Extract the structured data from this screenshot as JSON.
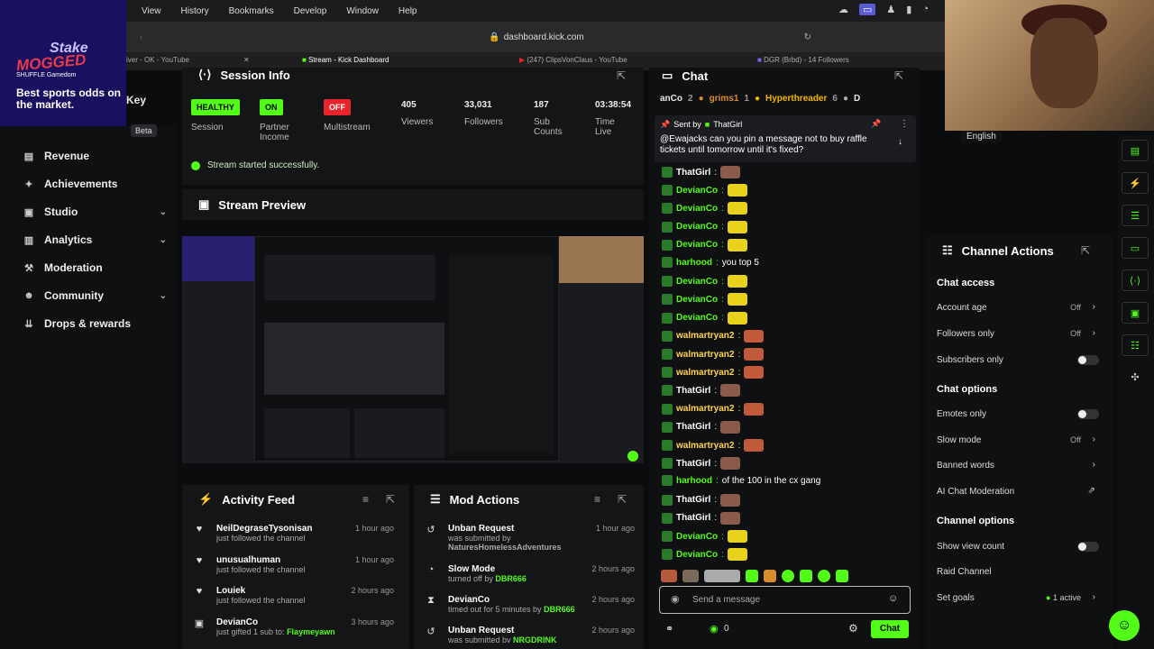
{
  "menubar": {
    "items": [
      "View",
      "History",
      "Bookmarks",
      "Develop",
      "Window",
      "Help"
    ]
  },
  "browser": {
    "url": "dashboard.kick.com",
    "tabs": [
      "iver - OK - YouTube",
      "Stream - Kick Dashboard",
      "(247) ClipsVonClaus - YouTube",
      "DGR (Brbd) - 14 Followers"
    ]
  },
  "promo": {
    "stake": "Stake",
    "mogged": "MOGGED",
    "brands": "SHUFFLE  Gamedom",
    "tagline": "Best sports odds on the market."
  },
  "webcam": {
    "language": "English"
  },
  "sidebar": {
    "partial_key": "Key",
    "beta": "Beta",
    "items": [
      {
        "label": "Revenue",
        "icon": "revenue-icon"
      },
      {
        "label": "Achievements",
        "icon": "achievements-icon"
      },
      {
        "label": "Studio",
        "icon": "studio-icon"
      },
      {
        "label": "Analytics",
        "icon": "analytics-icon"
      },
      {
        "label": "Moderation",
        "icon": "moderation-icon"
      },
      {
        "label": "Community",
        "icon": "community-icon"
      },
      {
        "label": "Drops & rewards",
        "icon": "drops-icon"
      }
    ]
  },
  "session": {
    "title": "Session Info",
    "metrics": [
      {
        "badge": "HEALTHY",
        "label": "Session",
        "color": "#53fc18"
      },
      {
        "badge": "ON",
        "label": "Partner Income",
        "color": "#53fc18"
      },
      {
        "badge": "OFF",
        "label": "Multistream",
        "color": "#e8232c"
      },
      {
        "value": "405",
        "label": "Viewers"
      },
      {
        "value": "33,031",
        "label": "Followers"
      },
      {
        "value": "187",
        "label": "Sub Counts"
      },
      {
        "value": "03:38:54",
        "label": "Time Live"
      }
    ],
    "success": "Stream started successfully."
  },
  "preview": {
    "title": "Stream Preview"
  },
  "activity": {
    "title": "Activity Feed",
    "items": [
      {
        "name": "NeilDegraseTysonisan",
        "sub": "just followed the channel",
        "time": "1 hour ago"
      },
      {
        "name": "unusualhuman",
        "sub": "just followed the channel",
        "time": "1 hour ago"
      },
      {
        "name": "Louiek",
        "sub": "just followed the channel",
        "time": "2 hours ago"
      },
      {
        "name": "DevianCo",
        "sub": "just gifted 1 sub to:",
        "target": "Flaymeyawn",
        "time": "3 hours ago"
      }
    ]
  },
  "mod": {
    "title": "Mod Actions",
    "items": [
      {
        "name": "Unban Request",
        "sub": "was submitted by",
        "target": "NaturesHomelessAdventures",
        "time": "1 hour ago"
      },
      {
        "name": "Slow Mode",
        "sub": "turned off by",
        "target": "DBR666",
        "time": "2 hours ago"
      },
      {
        "name": "DevianCo",
        "sub": "timed out for 5 minutes by",
        "target": "DBR666",
        "time": "2 hours ago"
      },
      {
        "name": "Unban Request",
        "sub": "was submitted by",
        "target": "NRGDRINK",
        "time": "2 hours ago"
      }
    ]
  },
  "chat": {
    "title": "Chat",
    "top": {
      "u1": "anCo",
      "n1": "2",
      "u2": "grims1",
      "n2": "1",
      "u3": "Hyperthreader",
      "n3": "6",
      "u4": "D"
    },
    "pinned_by": "Sent by",
    "pinned_user": "ThatGirl",
    "pinned_msg": "@Ewajacks can you pin a message not to buy raffle tickets until tomorrow until it's fixed?",
    "messages": [
      {
        "user": "ThatGirl",
        "color": "#ffffff",
        "text": ""
      },
      {
        "user": "DevianCo",
        "color": "#53fc18",
        "text": ""
      },
      {
        "user": "DevianCo",
        "color": "#53fc18",
        "text": ""
      },
      {
        "user": "DevianCo",
        "color": "#53fc18",
        "text": ""
      },
      {
        "user": "DevianCo",
        "color": "#53fc18",
        "text": ""
      },
      {
        "user": "harhood",
        "color": "#53fc18",
        "text": "you top 5"
      },
      {
        "user": "DevianCo",
        "color": "#53fc18",
        "text": ""
      },
      {
        "user": "DevianCo",
        "color": "#53fc18",
        "text": ""
      },
      {
        "user": "DevianCo",
        "color": "#53fc18",
        "text": ""
      },
      {
        "user": "walmartryan2",
        "color": "#ffd54a",
        "text": ""
      },
      {
        "user": "walmartryan2",
        "color": "#ffd54a",
        "text": ""
      },
      {
        "user": "walmartryan2",
        "color": "#ffd54a",
        "text": ""
      },
      {
        "user": "ThatGirl",
        "color": "#ffffff",
        "text": ""
      },
      {
        "user": "walmartryan2",
        "color": "#ffd54a",
        "text": ""
      },
      {
        "user": "ThatGirl",
        "color": "#ffffff",
        "text": ""
      },
      {
        "user": "walmartryan2",
        "color": "#ffd54a",
        "text": ""
      },
      {
        "user": "ThatGirl",
        "color": "#ffffff",
        "text": ""
      },
      {
        "user": "harhood",
        "color": "#53fc18",
        "text": "of the 100 in the cx gang"
      },
      {
        "user": "ThatGirl",
        "color": "#ffffff",
        "text": ""
      },
      {
        "user": "ThatGirl",
        "color": "#ffffff",
        "text": ""
      },
      {
        "user": "DevianCo",
        "color": "#53fc18",
        "text": ""
      },
      {
        "user": "DevianCo",
        "color": "#53fc18",
        "text": ""
      }
    ],
    "placeholder": "Send a message",
    "count": "0",
    "send": "Chat"
  },
  "actions": {
    "title": "Channel Actions",
    "access": "Chat access",
    "account_age": "Account age",
    "account_age_val": "Off",
    "followers_only": "Followers only",
    "followers_only_val": "Off",
    "subs_only": "Subscribers only",
    "options": "Chat options",
    "emotes_only": "Emotes only",
    "slow_mode": "Slow mode",
    "slow_mode_val": "Off",
    "banned": "Banned words",
    "ai": "AI Chat Moderation",
    "channel_opts": "Channel options",
    "show_count": "Show view count",
    "raid": "Raid Channel",
    "goals": "Set goals",
    "goals_val": "1 active"
  }
}
